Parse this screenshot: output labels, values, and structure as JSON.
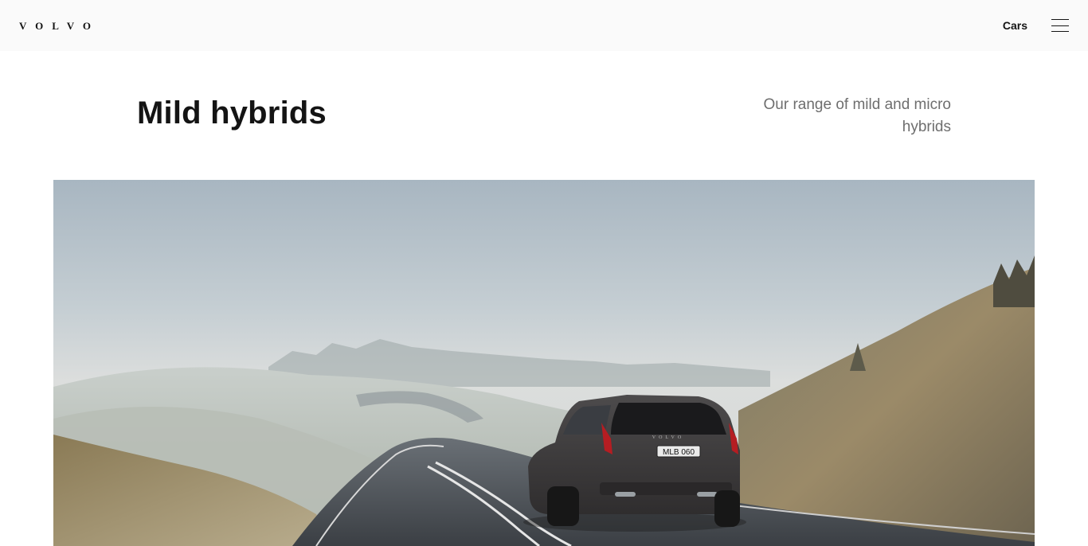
{
  "header": {
    "logo_text": "VOLVO",
    "nav_link": "Cars",
    "menu_icon": "hamburger-menu-icon"
  },
  "section": {
    "title": "Mild hybrids",
    "subtitle": "Our range of mild and micro hybrids"
  },
  "hero_image": {
    "plate_text": "MLB 060",
    "brand_on_car": "VOLVO"
  },
  "colors": {
    "topbar_bg": "#fafafa",
    "text_primary": "#141414",
    "text_secondary": "#6e6e6e"
  }
}
